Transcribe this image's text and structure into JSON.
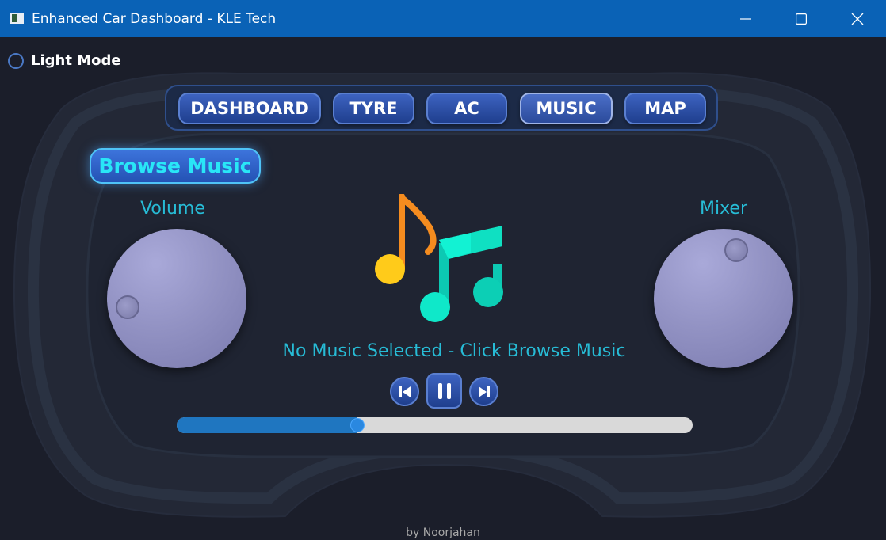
{
  "window": {
    "title": "Enhanced Car Dashboard - KLE Tech"
  },
  "theme_toggle": {
    "label": "Light Mode",
    "checked": false
  },
  "nav": {
    "tabs": [
      {
        "label": "DASHBOARD"
      },
      {
        "label": "TYRE"
      },
      {
        "label": "AC"
      },
      {
        "label": "MUSIC",
        "active": true
      },
      {
        "label": "MAP"
      }
    ]
  },
  "browse_button": {
    "label": "Browse Music"
  },
  "volume": {
    "label": "Volume"
  },
  "mixer": {
    "label": "Mixer"
  },
  "status_text": "No Music Selected - Click Browse Music",
  "controls": {
    "previous_icon": "skip-previous-icon",
    "pause_icon": "pause-icon",
    "next_icon": "skip-next-icon"
  },
  "progress": {
    "fraction": 0.35
  },
  "colors": {
    "accent": "#27bcd6",
    "button": "#2c4fa6",
    "titlebar": "#0a62b6"
  },
  "footer": {
    "credit": "by Noorjahan"
  }
}
